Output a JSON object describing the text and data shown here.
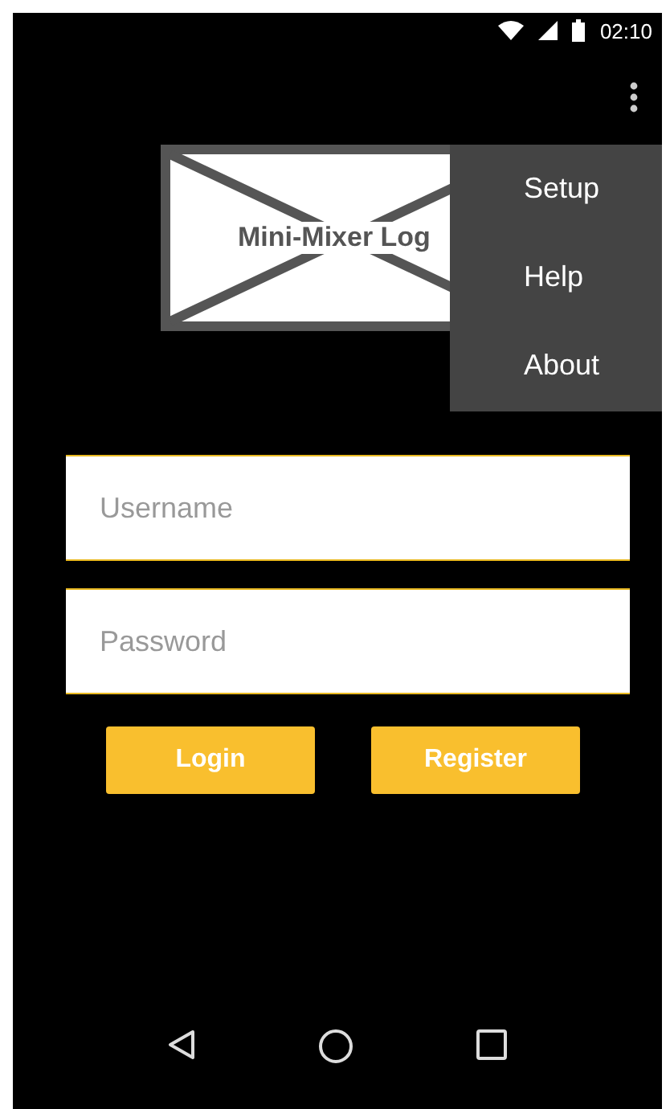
{
  "status_bar": {
    "time": "02:10"
  },
  "logo": {
    "text": "Mini-Mixer Log"
  },
  "overflow_menu": {
    "items": [
      {
        "label": "Setup"
      },
      {
        "label": "Help"
      },
      {
        "label": "About"
      }
    ]
  },
  "fields": [
    {
      "placeholder": "Username"
    },
    {
      "placeholder": "Password"
    }
  ],
  "buttons": [
    {
      "label": "Login"
    },
    {
      "label": "Register"
    }
  ]
}
